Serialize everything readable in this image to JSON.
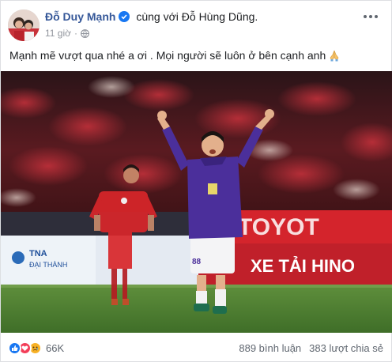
{
  "post": {
    "author": "Đỗ Duy Mạnh",
    "with_text": "cùng với",
    "tagged_person": "Đỗ Hùng Dũng.",
    "timestamp": "11 giờ",
    "privacy_icon": "globe-icon",
    "more_icon": "more-options-icon",
    "text": "Mạnh mẽ vượt qua nhé a ơi . Mọi người sẽ luôn ở bên cạnh anh",
    "text_emoji": "folded-hands-emoji"
  },
  "photo": {
    "billboard_left_line1": "TNA",
    "billboard_left_line2": "ĐẠI THÀNH",
    "billboard_right_top": "TOYOT",
    "billboard_right_bottom": "XE TẢI HINO",
    "jersey_number": "88"
  },
  "footer": {
    "reaction_icons": [
      "like-icon",
      "love-icon",
      "sad-icon"
    ],
    "reaction_count": "66K",
    "comments": "889 bình luận",
    "shares": "383 lượt chia sẻ"
  },
  "colors": {
    "author_link": "#365899",
    "meta_gray": "#90949c",
    "like_blue": "#1877f2",
    "love_red": "#f33e58",
    "sad_yellow": "#f7b125",
    "jersey_purple": "#4b2f9b",
    "jersey_red": "#d9262a"
  }
}
